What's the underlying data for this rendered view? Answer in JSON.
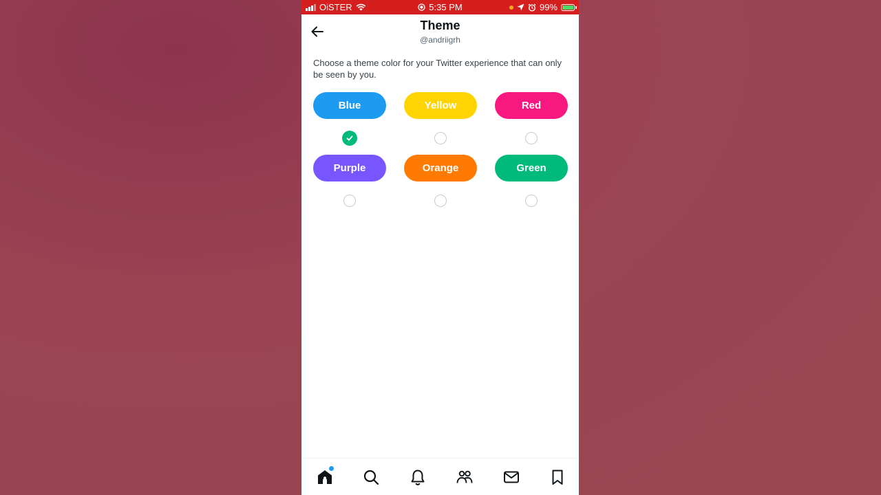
{
  "status_bar": {
    "carrier": "OiSTER",
    "time": "5:35 PM",
    "battery": "99%"
  },
  "header": {
    "title": "Theme",
    "handle": "@andriigrh"
  },
  "description": "Choose a theme color for your Twitter experience that can only be seen by you.",
  "themes": [
    {
      "label": "Blue",
      "color": "#1d9bf0",
      "selected": true
    },
    {
      "label": "Yellow",
      "color": "#ffd400",
      "selected": false
    },
    {
      "label": "Red",
      "color": "#f91880",
      "selected": false
    },
    {
      "label": "Purple",
      "color": "#7856ff",
      "selected": false
    },
    {
      "label": "Orange",
      "color": "#ff7a00",
      "selected": false
    },
    {
      "label": "Green",
      "color": "#00ba7c",
      "selected": false
    }
  ],
  "bottom_nav": [
    "home-icon",
    "search-icon",
    "bell-icon",
    "communities-icon",
    "mail-icon",
    "bookmark-icon"
  ],
  "colors": {
    "status_bar": "#d51f1f",
    "selected_check": "#00ba7c",
    "notification_dot": "#1d9bf0"
  }
}
